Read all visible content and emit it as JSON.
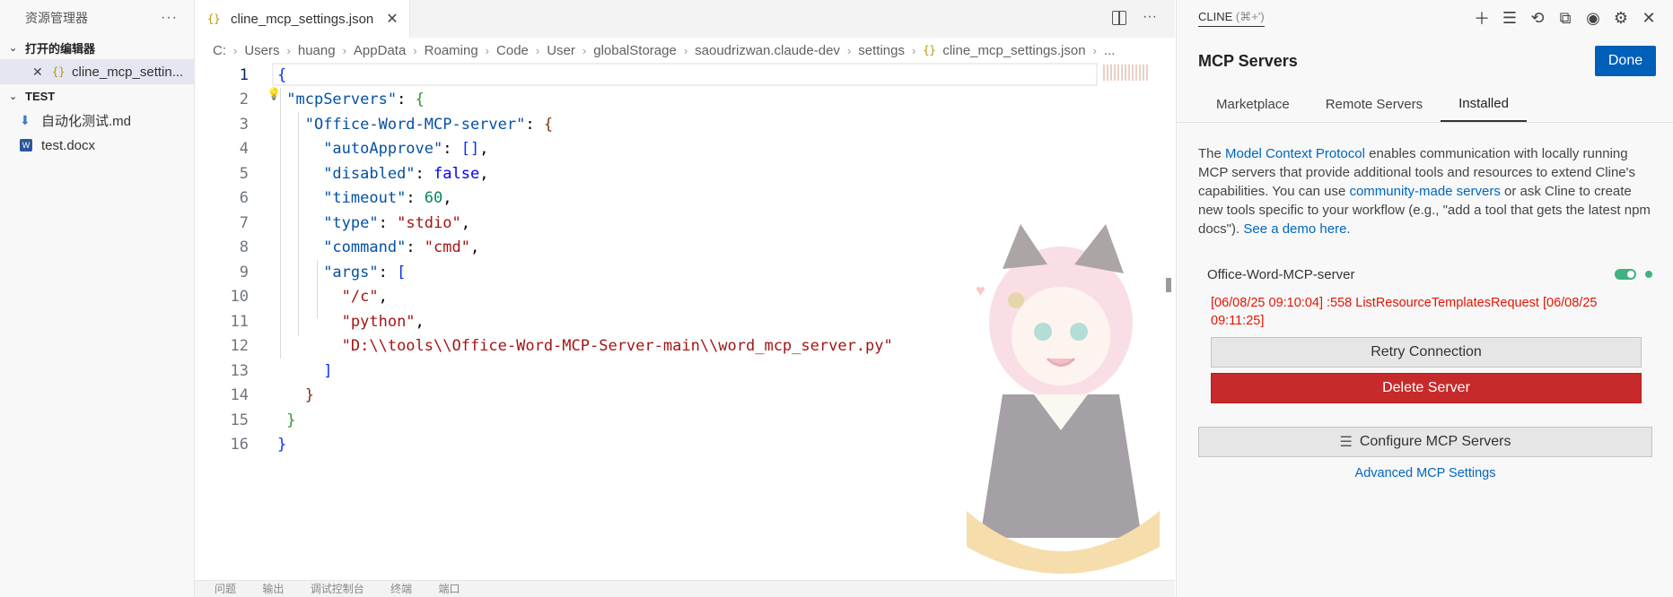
{
  "explorer": {
    "title": "资源管理器",
    "open_editors_label": "打开的编辑器",
    "open_editor_file": "cline_mcp_settin...",
    "workspace_label": "TEST",
    "files": [
      "自动化测试.md",
      "test.docx"
    ]
  },
  "editor": {
    "tab_label": "cline_mcp_settings.json",
    "breadcrumb": [
      "C:",
      "Users",
      "huang",
      "AppData",
      "Roaming",
      "Code",
      "User",
      "globalStorage",
      "saoudrizwan.claude-dev",
      "settings",
      "cline_mcp_settings.json",
      "..."
    ],
    "line_numbers": [
      "1",
      "2",
      "3",
      "4",
      "5",
      "6",
      "7",
      "8",
      "9",
      "10",
      "11",
      "12",
      "13",
      "14",
      "15",
      "16"
    ],
    "code": {
      "key_mcpServers": "\"mcpServers\"",
      "key_server": "\"Office-Word-MCP-server\"",
      "key_autoApprove": "\"autoApprove\"",
      "key_disabled": "\"disabled\"",
      "val_disabled": "false",
      "key_timeout": "\"timeout\"",
      "val_timeout": "60",
      "key_type": "\"type\"",
      "val_type": "\"stdio\"",
      "key_command": "\"command\"",
      "val_command": "\"cmd\"",
      "key_args": "\"args\"",
      "arg1": "\"/c\"",
      "arg2": "\"python\"",
      "arg3": "\"D:\\\\tools\\\\Office-Word-MCP-Server-main\\\\word_mcp_server.py\""
    },
    "bottom_panel_tabs": [
      "问题",
      "输出",
      "调试控制台",
      "终端",
      "端口"
    ]
  },
  "cline": {
    "title": "CLINE",
    "shortcut": "(⌘+')",
    "heading": "MCP Servers",
    "done_label": "Done",
    "tabs": [
      "Marketplace",
      "Remote Servers",
      "Installed"
    ],
    "intro": {
      "t1": "The ",
      "link1": "Model Context Protocol",
      "t2": " enables communication with locally running MCP servers that provide additional tools and resources to extend Cline's capabilities. You can use ",
      "link2": "community-made servers",
      "t3": " or ask Cline to create new tools specific to your workflow (e.g., \"add a tool that gets the latest npm docs\"). ",
      "link3": "See a demo here."
    },
    "server_name": "Office-Word-MCP-server",
    "server_enabled": true,
    "error_text": "[06/08/25 09:10:04] :558 ListResourceTemplatesRequest [06/08/25 09:11:25]",
    "retry_label": "Retry Connection",
    "delete_label": "Delete Server",
    "configure_label": "Configure MCP Servers",
    "advanced_label": "Advanced MCP Settings"
  },
  "colors": {
    "accent": "#005fb8",
    "danger": "#c72a2a",
    "link": "#0066bf",
    "error": "#e51400",
    "status": "#3fb27f"
  }
}
